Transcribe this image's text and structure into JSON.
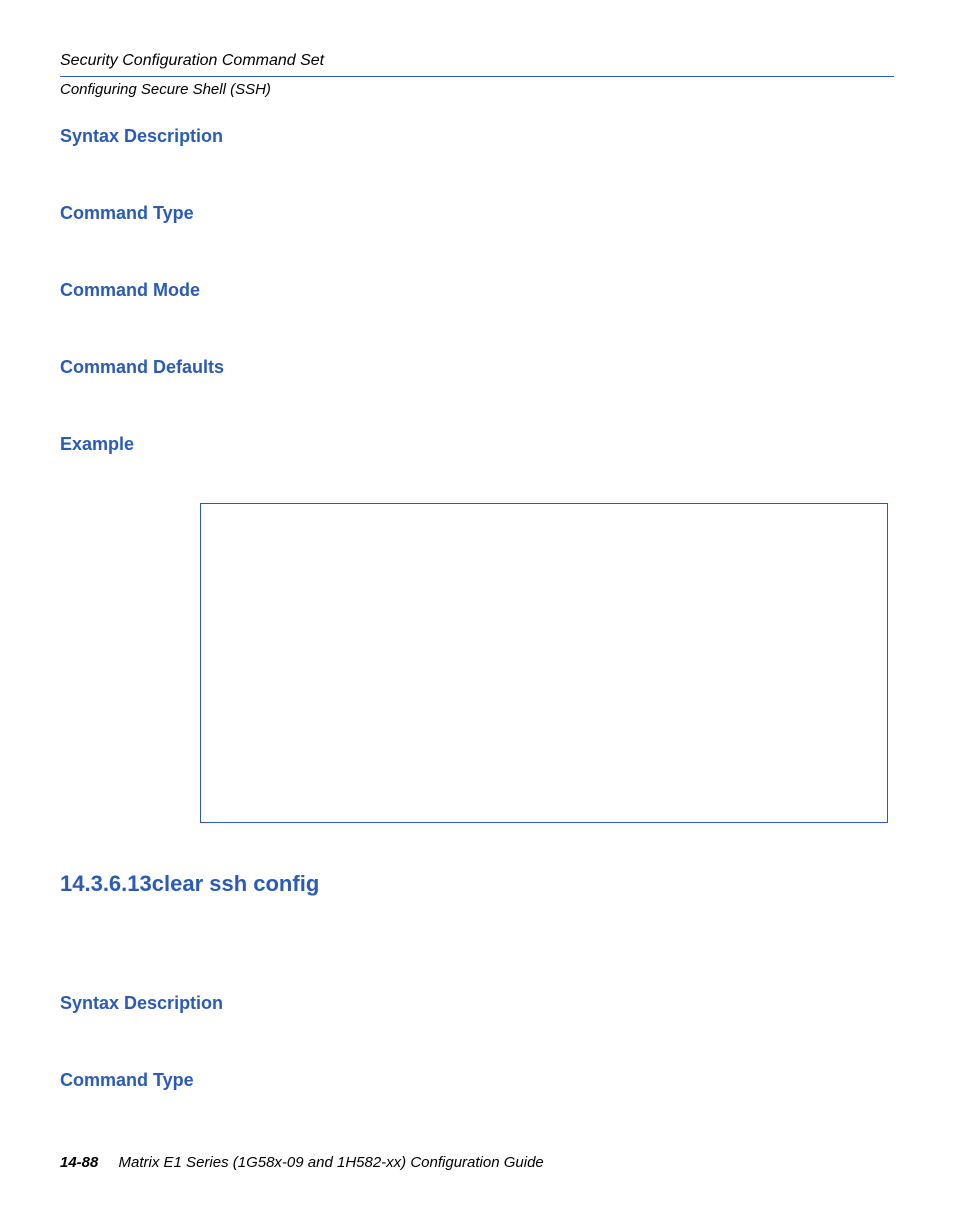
{
  "header": {
    "section": "Security Configuration Command Set",
    "subsection": "Configuring Secure Shell (SSH)"
  },
  "headings": {
    "h1": "Syntax Description",
    "h2": "Command Type",
    "h3": "Command Mode",
    "h4": "Command Defaults",
    "h5": "Example"
  },
  "command": {
    "title": "14.3.6.13clear ssh config"
  },
  "headings2": {
    "h1": "Syntax Description",
    "h2": "Command Type"
  },
  "footer": {
    "page": "14-88",
    "doc": "Matrix E1 Series (1G58x-09 and 1H582-xx) Configuration Guide"
  }
}
